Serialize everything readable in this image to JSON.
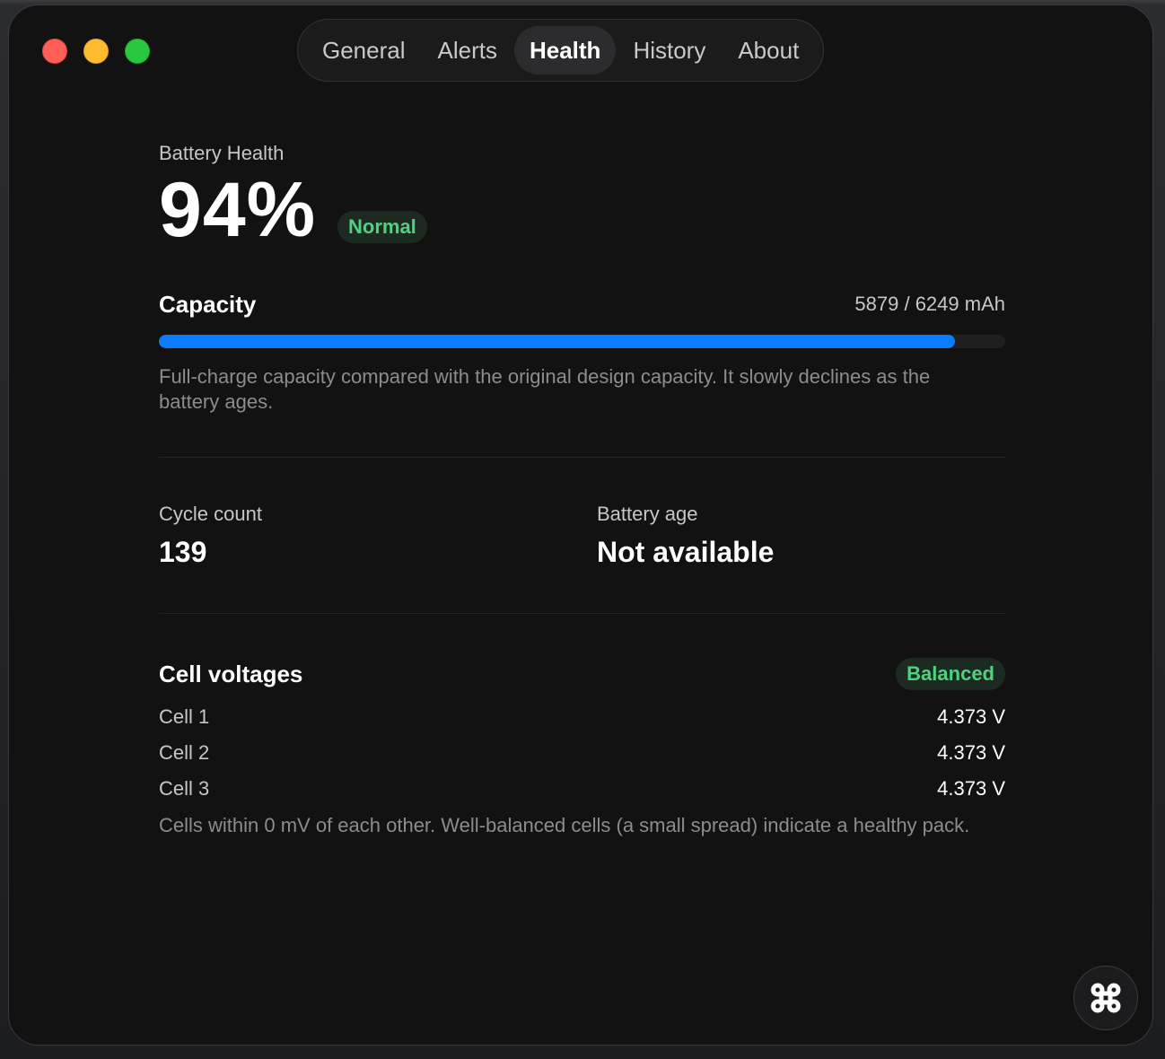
{
  "tabs": [
    {
      "label": "General",
      "active": false
    },
    {
      "label": "Alerts",
      "active": false
    },
    {
      "label": "Health",
      "active": true
    },
    {
      "label": "History",
      "active": false
    },
    {
      "label": "About",
      "active": false
    }
  ],
  "health": {
    "label": "Battery Health",
    "percent": "94%",
    "status": "Normal"
  },
  "capacity": {
    "title": "Capacity",
    "value": "5879 / 6249 mAh",
    "fraction": 0.9408,
    "description": "Full-charge capacity compared with the original design capacity. It slowly declines as the battery ages."
  },
  "stats": {
    "cycle_label": "Cycle count",
    "cycle_value": "139",
    "age_label": "Battery age",
    "age_value": "Not available"
  },
  "cells": {
    "title": "Cell voltages",
    "status": "Balanced",
    "items": [
      {
        "name": "Cell 1",
        "value": "4.373 V"
      },
      {
        "name": "Cell 2",
        "value": "4.373 V"
      },
      {
        "name": "Cell 3",
        "value": "4.373 V"
      }
    ],
    "description": "Cells within 0 mV of each other. Well-balanced cells (a small spread) indicate a healthy pack."
  },
  "colors": {
    "accent": "#0a7cff",
    "ok": "#4fd27e",
    "window_bg": "#121212"
  },
  "icons": {
    "corner_button": "command-icon"
  }
}
